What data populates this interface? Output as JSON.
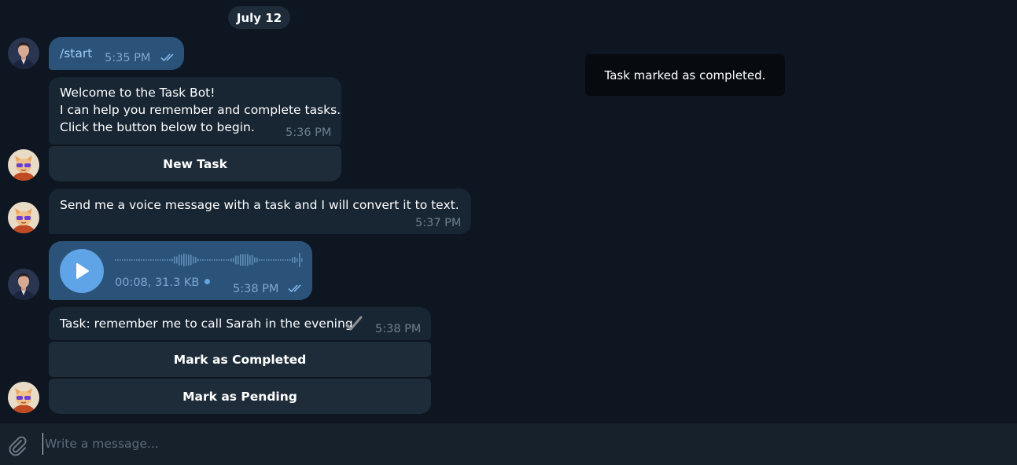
{
  "date_separator": "July 12",
  "toast": "Task marked as completed.",
  "messages": {
    "start": {
      "text": "/start",
      "time": "5:35 PM"
    },
    "welcome": {
      "line1": "Welcome to the Task Bot!",
      "line2": "I can help you remember and complete tasks.",
      "line3": "Click the button below to begin.",
      "time": "5:36 PM"
    },
    "new_task_button": "New Task",
    "send_voice": {
      "text": "Send me a voice message with a task and I will convert it to text.",
      "time": "5:37 PM"
    },
    "voice": {
      "meta": "00:08, 31.3 KB",
      "time": "5:38 PM"
    },
    "task": {
      "text": "Task: remember me to call Sarah in the evening",
      "time": "5:38 PM"
    },
    "mark_completed_button": "Mark as Completed",
    "mark_pending_button": "Mark as Pending"
  },
  "composer": {
    "placeholder": "Write a message..."
  },
  "colors": {
    "background": "#0e1621",
    "outgoing_bubble": "#2b5278",
    "incoming_bubble": "#182533",
    "accent": "#5fa4e6"
  },
  "icons": {
    "read_receipt": "double-check-icon",
    "attach": "paperclip-icon",
    "play": "play-icon",
    "task_check": "check-icon"
  }
}
